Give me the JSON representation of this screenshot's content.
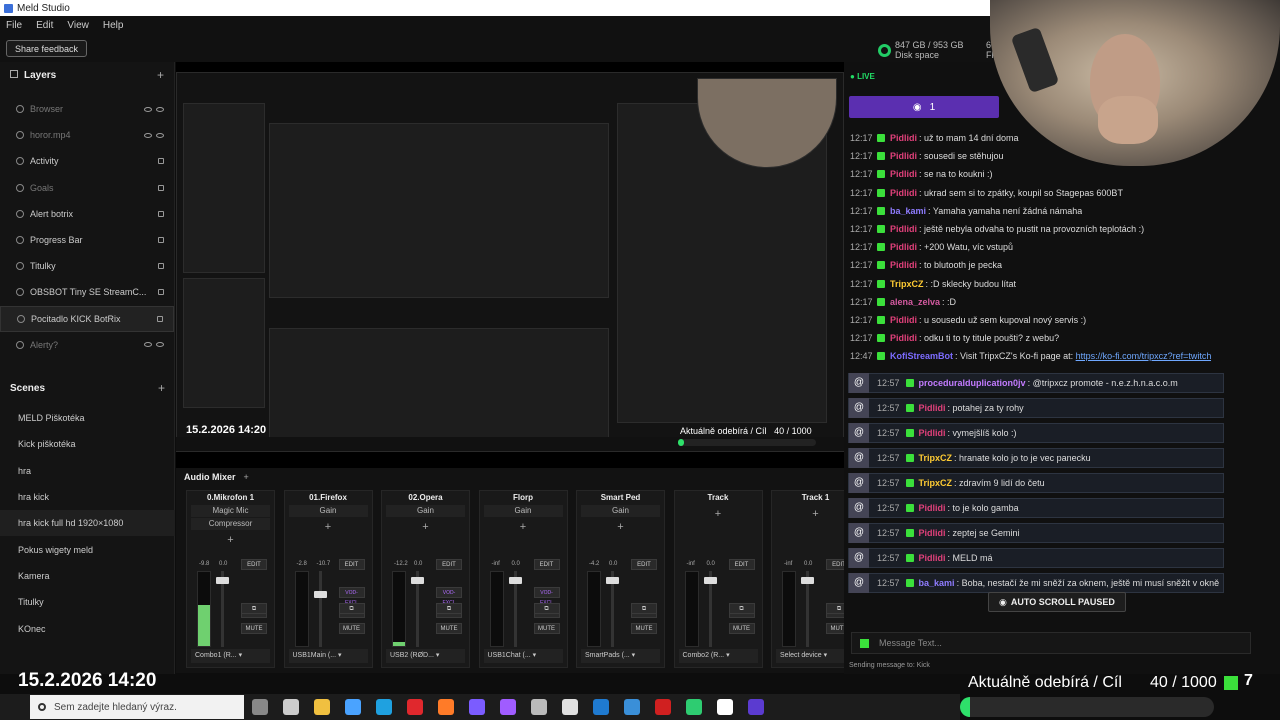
{
  "window": {
    "title": "Meld Studio"
  },
  "menu": [
    "File",
    "Edit",
    "View",
    "Help"
  ],
  "toolbar": {
    "share_feedback": "Share feedback"
  },
  "stats": {
    "disk_used": "847 GB / 953 GB",
    "disk_label": "Disk space",
    "fps_value": "60.",
    "fps_label": "FP"
  },
  "layers": {
    "title": "Layers",
    "items": [
      {
        "label": "Browser"
      },
      {
        "label": "horor.mp4"
      },
      {
        "label": "Activity"
      },
      {
        "label": "Goals"
      },
      {
        "label": "Alert botrix"
      },
      {
        "label": "Progress Bar"
      },
      {
        "label": "Titulky"
      },
      {
        "label": "OBSBOT Tiny SE StreamC..."
      },
      {
        "label": "Pocitadlo KICK BotRix"
      },
      {
        "label": "Alerty?"
      }
    ]
  },
  "scenes": {
    "title": "Scenes",
    "items": [
      {
        "label": "MELD Piškotéka"
      },
      {
        "label": "Kick piškotéka"
      },
      {
        "label": "hra"
      },
      {
        "label": "hra kick"
      },
      {
        "label": "hra kick full hd 1920×1080"
      },
      {
        "label": "Pokus wigety meld"
      },
      {
        "label": "Kamera"
      },
      {
        "label": "Titulky"
      },
      {
        "label": "KOnec"
      }
    ]
  },
  "overlay": {
    "datetime": "15.2.2026 14:20",
    "subs_label": "Aktuálně odebírá / Cíl",
    "subs_count": "40 / 1000",
    "kick_number": "7",
    "progress": 0.04
  },
  "mixer": {
    "title": "Audio Mixer",
    "channels": [
      {
        "name": "0.Mikrofon 1",
        "fx": [
          "Magic Mic",
          "Compressor"
        ],
        "db_left": "-9.8",
        "db_right": "0.0",
        "device": "Combo1 (R...",
        "level": 0.55,
        "fader": 0.92
      },
      {
        "name": "01.Firefox",
        "fx": [
          "Gain"
        ],
        "db_left": "-2.8",
        "db_right": "-10.7",
        "device": "USB1Main (...",
        "level": 0.0,
        "fader": 0.72,
        "vod": "VOD-EXCL"
      },
      {
        "name": "02.Opera",
        "fx": [
          "Gain"
        ],
        "db_left": "-12.2",
        "db_right": "0.0",
        "device": "USB2 (RØD...",
        "level": 0.05,
        "fader": 0.92,
        "vod": "VOD-EXCL"
      },
      {
        "name": "Florp",
        "fx": [
          "Gain"
        ],
        "db_left": "-inf",
        "db_right": "0.0",
        "device": "USB1Chat (...",
        "level": 0.0,
        "fader": 0.92,
        "vod": "VOD-EXCL"
      },
      {
        "name": "Smart Ped",
        "fx": [
          "Gain"
        ],
        "db_left": "-4.2",
        "db_right": "0.0",
        "device": "SmartPads (...",
        "level": 0.0,
        "fader": 0.92
      },
      {
        "name": "Track",
        "fx": [],
        "db_left": "-inf",
        "db_right": "0.0",
        "device": "Combo2 (R...",
        "level": 0.0,
        "fader": 0.92
      },
      {
        "name": "Track 1",
        "fx": [],
        "db_left": "-inf",
        "db_right": "0.0",
        "device": "Select device",
        "level": 0.0,
        "fader": 0.92
      }
    ],
    "buttons": {
      "edit": "EDIT",
      "cue": "CUE",
      "mute": "MUTE"
    }
  },
  "chat": {
    "live": "LIVE",
    "viewers": "1",
    "colors": {
      "pidlidi": "#e0407a",
      "bakami": "#8f7cff",
      "tripx": "#ffcc33",
      "bot": "#7c6cff",
      "proc": "#c37bff",
      "alena": "#d45aa0"
    },
    "messages": [
      {
        "time": "12:17",
        "user": "Pidlidi",
        "color": "#e0407a",
        "text": ": už to mam 14 dní doma"
      },
      {
        "time": "12:17",
        "user": "Pidlidi",
        "color": "#e0407a",
        "text": ": sousedi se stěhujou"
      },
      {
        "time": "12:17",
        "user": "Pidlidi",
        "color": "#e0407a",
        "text": ": se na to koukni :)"
      },
      {
        "time": "12:17",
        "user": "Pidlidi",
        "color": "#e0407a",
        "text": ": ukrad sem si to zpátky, koupil so Stagepas 600BT"
      },
      {
        "time": "12:17",
        "user": "ba_kami",
        "color": "#8f7cff",
        "text": ": Yamaha yamaha není žádná námaha"
      },
      {
        "time": "12:17",
        "user": "Pidlidi",
        "color": "#e0407a",
        "text": ": ještě nebyla odvaha to pustit na provozních teplotách :)"
      },
      {
        "time": "12:17",
        "user": "Pidlidi",
        "color": "#e0407a",
        "text": ": +200 Watu, víc vstupů"
      },
      {
        "time": "12:17",
        "user": "Pidlidi",
        "color": "#e0407a",
        "text": ": to blutooth je pecka"
      },
      {
        "time": "12:17",
        "user": "TripxCZ",
        "color": "#ffcc33",
        "text": ": :D sklecky budou lítat"
      },
      {
        "time": "12:17",
        "user": "alena_zelva",
        "color": "#d45aa0",
        "text": ": :D"
      },
      {
        "time": "12:17",
        "user": "Pidlidi",
        "color": "#e0407a",
        "text": ": u sousedu už sem kupoval nový servis :)"
      },
      {
        "time": "12:17",
        "user": "Pidlidi",
        "color": "#e0407a",
        "text": ": odku ti to ty titule poušti? z webu?"
      },
      {
        "time": "12:47",
        "user": "KofiStreamBot",
        "color": "#7c6cff",
        "text": ": Visit TripxCZ's Ko-fi page at: ",
        "link": "https://ko-fi.com/tripxcz?ref=twitch"
      }
    ],
    "cards": [
      {
        "time": "12:57",
        "user": "proceduralduplication0jv",
        "color": "#c37bff",
        "text": ": @tripxcz promote - n.e.z.h.n.a.c.o.m"
      },
      {
        "time": "12:57",
        "user": "Pidlidi",
        "color": "#e0407a",
        "text": ": potahej za ty rohy"
      },
      {
        "time": "12:57",
        "user": "Pidlidi",
        "color": "#e0407a",
        "text": ": vymejšlíš kolo :)"
      },
      {
        "time": "12:57",
        "user": "TripxCZ",
        "color": "#ffcc33",
        "text": ": hranate kolo jo to je vec panecku"
      },
      {
        "time": "12:57",
        "user": "TripxCZ",
        "color": "#ffcc33",
        "text": ": zdravím 9 lidí do četu"
      },
      {
        "time": "12:57",
        "user": "Pidlidi",
        "color": "#e0407a",
        "text": ": to je kolo gamba"
      },
      {
        "time": "12:57",
        "user": "Pidlidi",
        "color": "#e0407a",
        "text": ": zeptej se Gemini"
      },
      {
        "time": "12:57",
        "user": "Pidlidi",
        "color": "#e0407a",
        "text": ": MELD má"
      },
      {
        "time": "12:57",
        "user": "ba_kami",
        "color": "#8f7cff",
        "text": ": Boba, nestačí že mi sněží za oknem, ještě mi musí sněžit v okně"
      }
    ],
    "auto_scroll": "AUTO SCROLL PAUSED",
    "input_placeholder": "Message Text...",
    "sending": "Sending message to: Kick"
  },
  "taskbar": {
    "search_placeholder": "Sem zadejte hledaný výraz."
  }
}
